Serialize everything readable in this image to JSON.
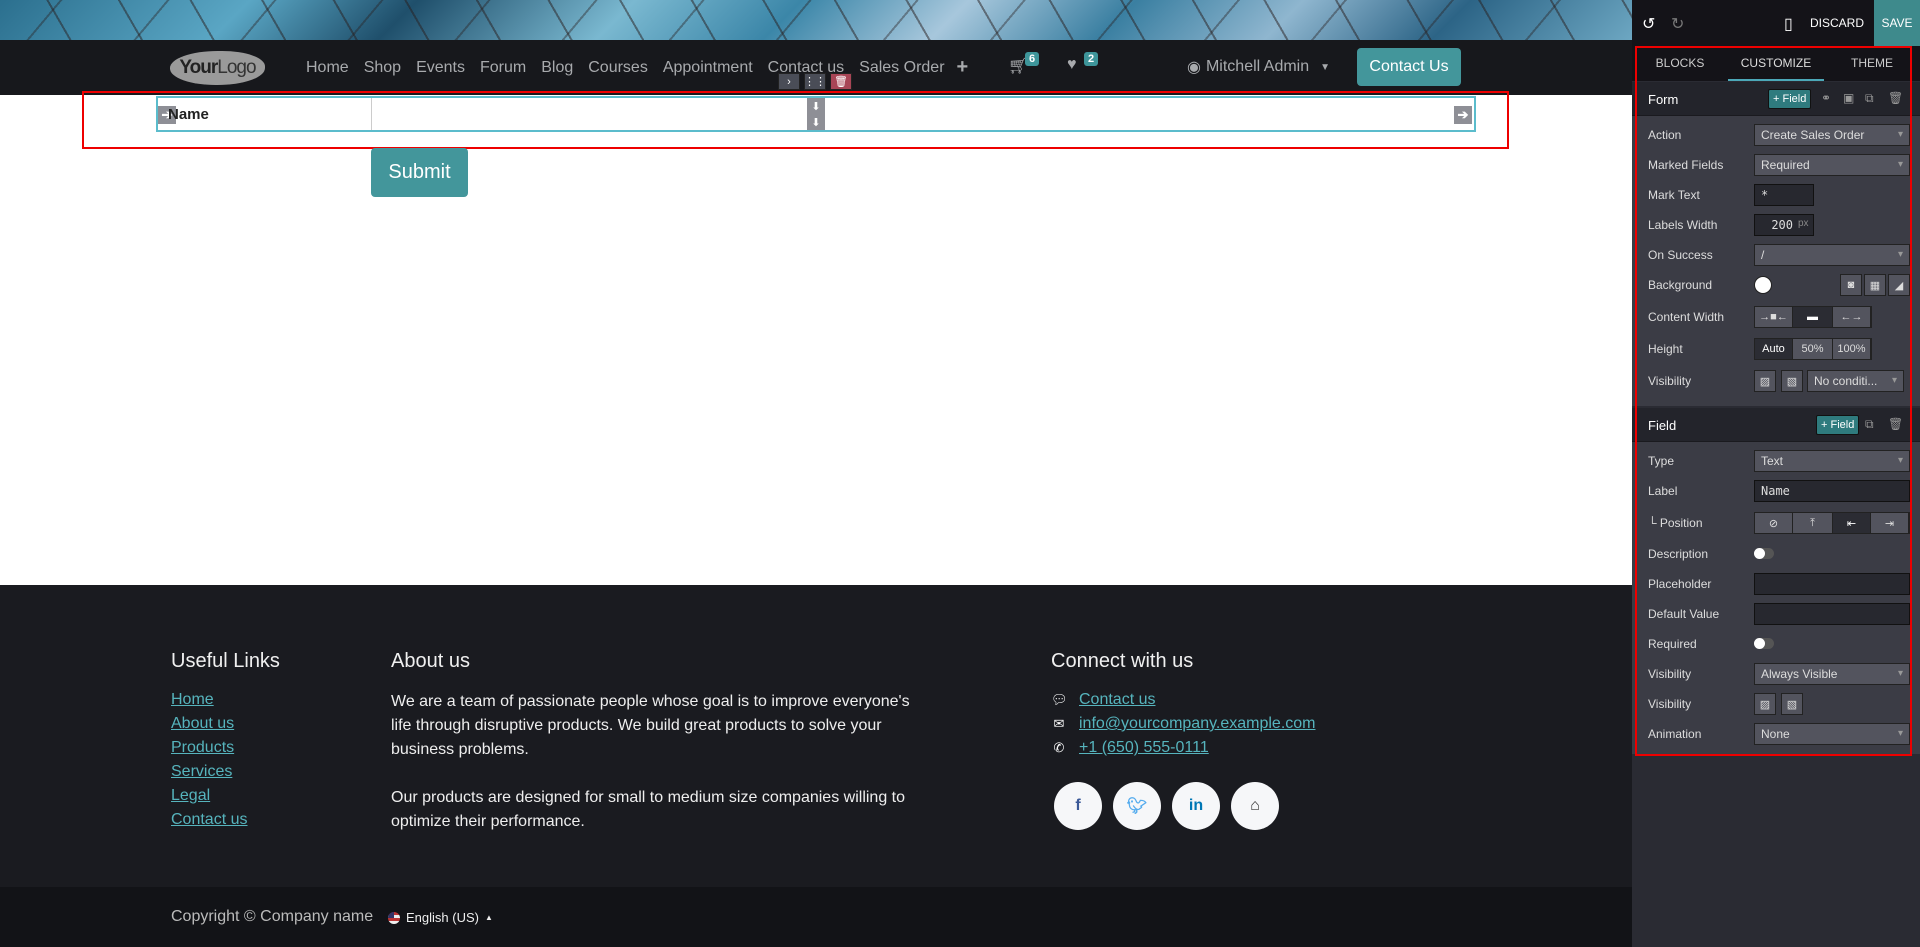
{
  "navbar": {
    "logo": {
      "bold": "Your",
      "light": "Logo"
    },
    "links": [
      "Home",
      "Shop",
      "Events",
      "Forum",
      "Blog",
      "Courses",
      "Appointment",
      "Contact us",
      "Sales Order"
    ],
    "cart_count": "6",
    "wishlist_count": "2",
    "user_name": "Mitchell Admin",
    "contact_button": "Contact Us"
  },
  "snippet_tools": {
    "move": "›",
    "grid": "⋮⋮",
    "delete": "🗑"
  },
  "form": {
    "field_label": "Name",
    "submit_label": "Submit"
  },
  "footer": {
    "useful_links_title": "Useful Links",
    "useful_links": [
      "Home",
      "About us",
      "Products",
      "Services",
      "Legal",
      "Contact us"
    ],
    "about_title": "About us",
    "about_paragraphs": [
      "We are a team of passionate people whose goal is to improve everyone's life through disruptive products. We build great products to solve your business problems.",
      "Our products are designed for small to medium size companies willing to optimize their performance."
    ],
    "connect_title": "Connect with us",
    "connect_items": [
      {
        "icon": "comment-icon",
        "text": "Contact us"
      },
      {
        "icon": "envelope-icon",
        "text": "info@yourcompany.example.com"
      },
      {
        "icon": "phone-icon",
        "text": "+1 (650) 555-0111"
      }
    ],
    "socials": [
      "facebook",
      "twitter",
      "linkedin",
      "home"
    ],
    "copyright": "Copyright © Company name",
    "language": "English (US)"
  },
  "editor": {
    "discard": "DISCARD",
    "save": "SAVE",
    "tabs": [
      "BLOCKS",
      "CUSTOMIZE",
      "THEME"
    ],
    "active_tab": "CUSTOMIZE",
    "form_section": {
      "title": "Form",
      "add_field": "+ Field",
      "action_label": "Action",
      "action_value": "Create Sales Order",
      "marked_label": "Marked Fields",
      "marked_value": "Required",
      "mark_text_label": "Mark Text",
      "mark_text_value": "*",
      "labels_width_label": "Labels Width",
      "labels_width_value": "200",
      "labels_width_unit": "px",
      "on_success_label": "On Success",
      "on_success_value": "/",
      "background_label": "Background",
      "content_width_label": "Content Width",
      "height_label": "Height",
      "height_options": [
        "Auto",
        "50%",
        "100%"
      ],
      "height_selected": "Auto",
      "visibility_label": "Visibility",
      "visibility_value": "No conditi..."
    },
    "field_section": {
      "title": "Field",
      "add_field": "+ Field",
      "type_label": "Type",
      "type_value": "Text",
      "label_label": "Label",
      "label_value": "Name",
      "position_label": "└ Position",
      "description_label": "Description",
      "placeholder_label": "Placeholder",
      "placeholder_value": "",
      "default_label": "Default Value",
      "default_value": "",
      "required_label": "Required",
      "visibility_label": "Visibility",
      "visibility_value": "Always Visible",
      "visibility2_label": "Visibility",
      "animation_label": "Animation",
      "animation_value": "None"
    }
  }
}
